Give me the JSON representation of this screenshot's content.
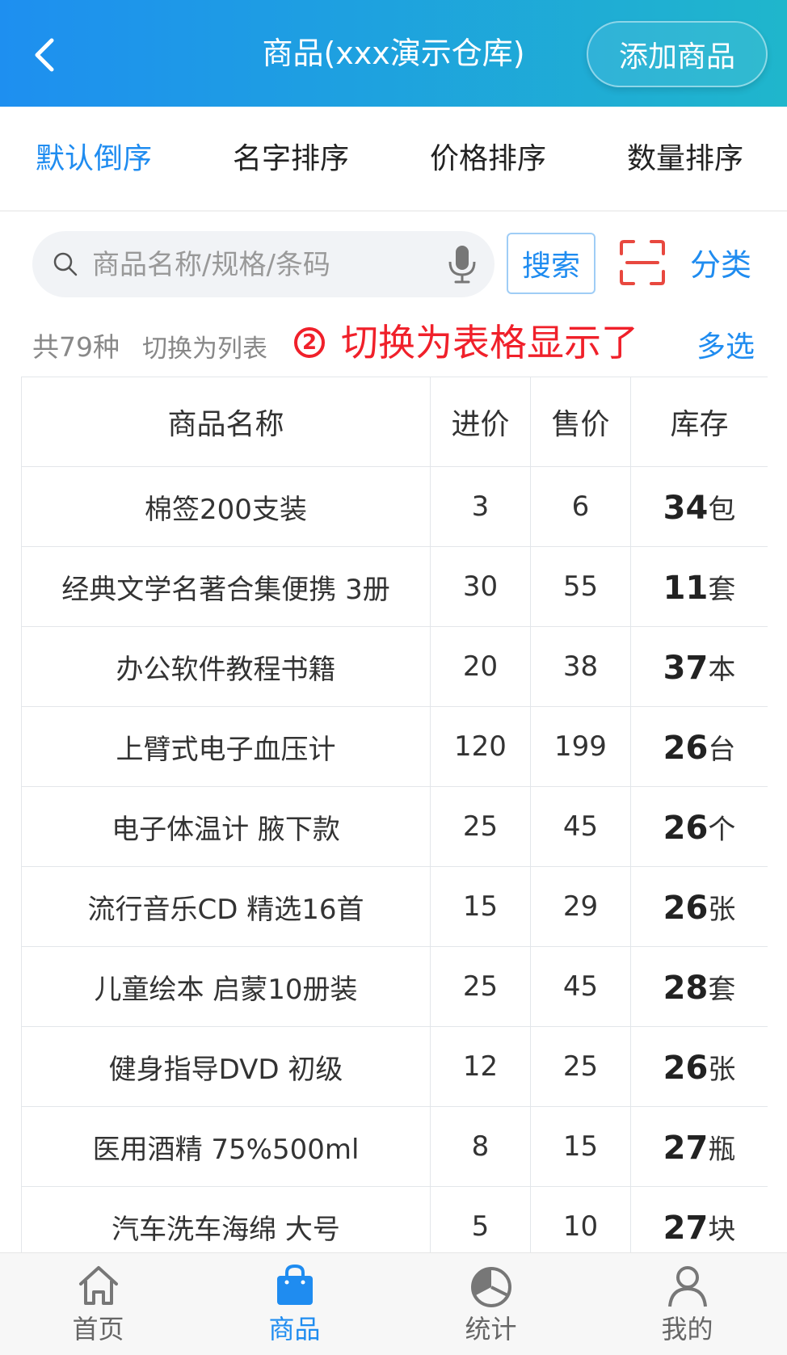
{
  "header": {
    "title": "商品(xxx演示仓库)",
    "add_button": "添加商品"
  },
  "sort_tabs": [
    {
      "label": "默认倒序",
      "active": true
    },
    {
      "label": "名字排序",
      "active": false
    },
    {
      "label": "价格排序",
      "active": false
    },
    {
      "label": "数量排序",
      "active": false
    }
  ],
  "search": {
    "placeholder": "商品名称/规格/条码",
    "value": "",
    "button": "搜索",
    "category": "分类"
  },
  "info": {
    "count_text": "共79种",
    "switch_link": "切换为列表",
    "annotation_number": "2",
    "annotation_text": "切换为表格显示了",
    "multi_select": "多选"
  },
  "table": {
    "headers": [
      "商品名称",
      "进价",
      "售价",
      "库存"
    ],
    "rows": [
      {
        "name": "棉签200支装",
        "buy": "3",
        "sell": "6",
        "stock": "34",
        "unit": "包"
      },
      {
        "name": "经典文学名著合集便携  3册",
        "buy": "30",
        "sell": "55",
        "stock": "11",
        "unit": "套"
      },
      {
        "name": "办公软件教程书籍",
        "buy": "20",
        "sell": "38",
        "stock": "37",
        "unit": "本"
      },
      {
        "name": "上臂式电子血压计",
        "buy": "120",
        "sell": "199",
        "stock": "26",
        "unit": "台"
      },
      {
        "name": "电子体温计  腋下款",
        "buy": "25",
        "sell": "45",
        "stock": "26",
        "unit": "个"
      },
      {
        "name": "流行音乐CD  精选16首",
        "buy": "15",
        "sell": "29",
        "stock": "26",
        "unit": "张"
      },
      {
        "name": "儿童绘本  启蒙10册装",
        "buy": "25",
        "sell": "45",
        "stock": "28",
        "unit": "套"
      },
      {
        "name": "健身指导DVD  初级",
        "buy": "12",
        "sell": "25",
        "stock": "26",
        "unit": "张"
      },
      {
        "name": "医用酒精  75%500ml",
        "buy": "8",
        "sell": "15",
        "stock": "27",
        "unit": "瓶"
      },
      {
        "name": "汽车洗车海绵  大号",
        "buy": "5",
        "sell": "10",
        "stock": "27",
        "unit": "块"
      }
    ]
  },
  "tabbar": [
    {
      "label": "首页",
      "icon": "home-icon",
      "active": false
    },
    {
      "label": "商品",
      "icon": "shopping-bag-icon",
      "active": true
    },
    {
      "label": "统计",
      "icon": "pie-chart-icon",
      "active": false
    },
    {
      "label": "我的",
      "icon": "user-icon",
      "active": false
    }
  ],
  "colors": {
    "accent": "#1f8cf0",
    "header_gradient_start": "#1e8ff0",
    "header_gradient_end": "#1fb6cc",
    "annotation": "#f0202a"
  }
}
